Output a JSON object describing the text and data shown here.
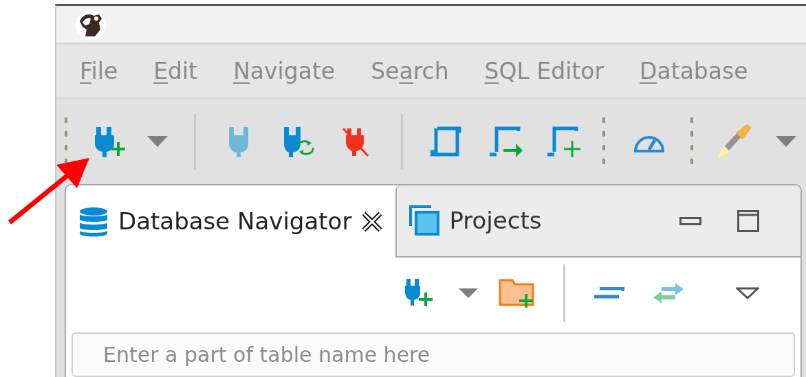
{
  "menu": [
    {
      "key": "F",
      "suffix": "ile"
    },
    {
      "key": "E",
      "suffix": "dit"
    },
    {
      "key": "N",
      "suffix": "avigate"
    },
    {
      "prefix": "Se",
      "key": "a",
      "suffix": "rch"
    },
    {
      "key": "S",
      "suffix": "QL Editor"
    },
    {
      "key": "D",
      "suffix": "atabase"
    }
  ],
  "tabs": [
    {
      "label": "Database Navigator",
      "selected": true,
      "closable": true
    },
    {
      "label": "Projects",
      "selected": false,
      "closable": false
    }
  ],
  "search": {
    "placeholder": "Enter a part of table name here"
  }
}
